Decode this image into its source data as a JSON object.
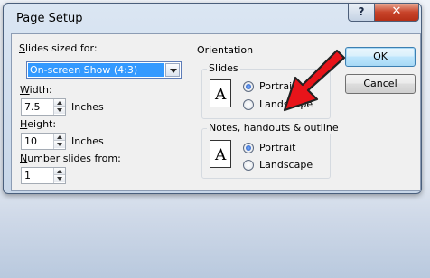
{
  "window": {
    "title": "Page Setup",
    "help_glyph": "?",
    "close_glyph": "✕"
  },
  "left": {
    "slides_sized_for_label": "Slides sized for:",
    "slides_sized_for_value": "On-screen Show (4:3)",
    "width_label": "Width:",
    "width_value": "7.5",
    "width_unit": "Inches",
    "height_label": "Height:",
    "height_value": "10",
    "height_unit": "Inches",
    "number_from_label": "Number slides from:",
    "number_from_value": "1"
  },
  "orientation": {
    "title": "Orientation",
    "slides": {
      "title": "Slides",
      "icon_letter": "A",
      "portrait": "Portrait",
      "landscape": "Landscape",
      "selected": "portrait"
    },
    "notes": {
      "title": "Notes, handouts & outline",
      "icon_letter": "A",
      "portrait": "Portrait",
      "landscape": "Landscape",
      "selected": "portrait"
    }
  },
  "buttons": {
    "ok": "OK",
    "cancel": "Cancel"
  },
  "annotation": {
    "arrow_color": "#e8141a",
    "icon": "red-arrow-icon"
  }
}
